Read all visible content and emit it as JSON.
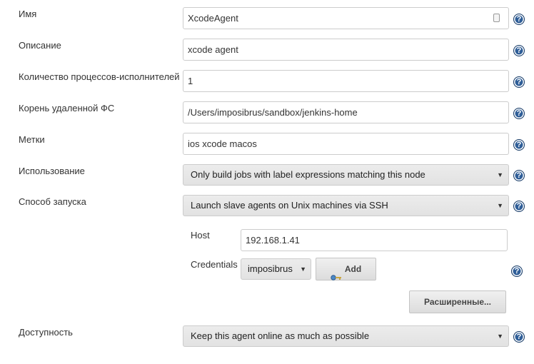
{
  "fields": {
    "name": {
      "label": "Имя",
      "value": "XcodeAgent"
    },
    "description": {
      "label": "Описание",
      "value": "xcode agent"
    },
    "executors": {
      "label": "Количество процессов-исполнителей",
      "value": "1"
    },
    "remote_fs": {
      "label": "Корень удаленной ФС",
      "value": "/Users/imposibrus/sandbox/jenkins-home"
    },
    "labels": {
      "label": "Метки",
      "value": "ios xcode macos"
    },
    "usage": {
      "label": "Использование",
      "selected": "Only build jobs with label expressions matching this node"
    },
    "launch": {
      "label": "Способ запуска",
      "selected": "Launch slave agents on Unix machines via SSH"
    },
    "availability": {
      "label": "Доступность",
      "selected": "Keep this agent online as much as possible"
    }
  },
  "ssh": {
    "host_label": "Host",
    "host_value": "192.168.1.41",
    "credentials_label": "Credentials",
    "credentials_selected": "imposibrus",
    "add_label": "Add",
    "advanced_label": "Расширенные..."
  },
  "icons": {
    "help": "help-icon",
    "key": "key-icon",
    "password_manager": "password-manager-icon",
    "dropdown": "chevron-down-icon"
  },
  "help_glyph": "?",
  "caret_glyph": "▼",
  "colors": {
    "help_icon": "#2f5e98",
    "select_bg": "#e6e6e6",
    "border": "#cccccc"
  }
}
